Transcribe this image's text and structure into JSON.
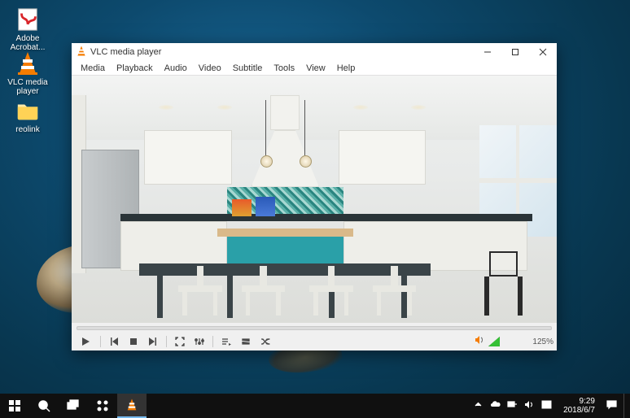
{
  "desktop_icons": {
    "adobe": "Adobe Acrobat...",
    "vlc": "VLC media player",
    "reolink": "reolink"
  },
  "vlc": {
    "title": "VLC media player",
    "menu": {
      "media": "Media",
      "playback": "Playback",
      "audio": "Audio",
      "video": "Video",
      "subtitle": "Subtitle",
      "tools": "Tools",
      "view": "View",
      "help": "Help"
    },
    "volume_pct": "125%"
  },
  "taskbar": {
    "time": "9:29",
    "date": "2018/6/7"
  }
}
